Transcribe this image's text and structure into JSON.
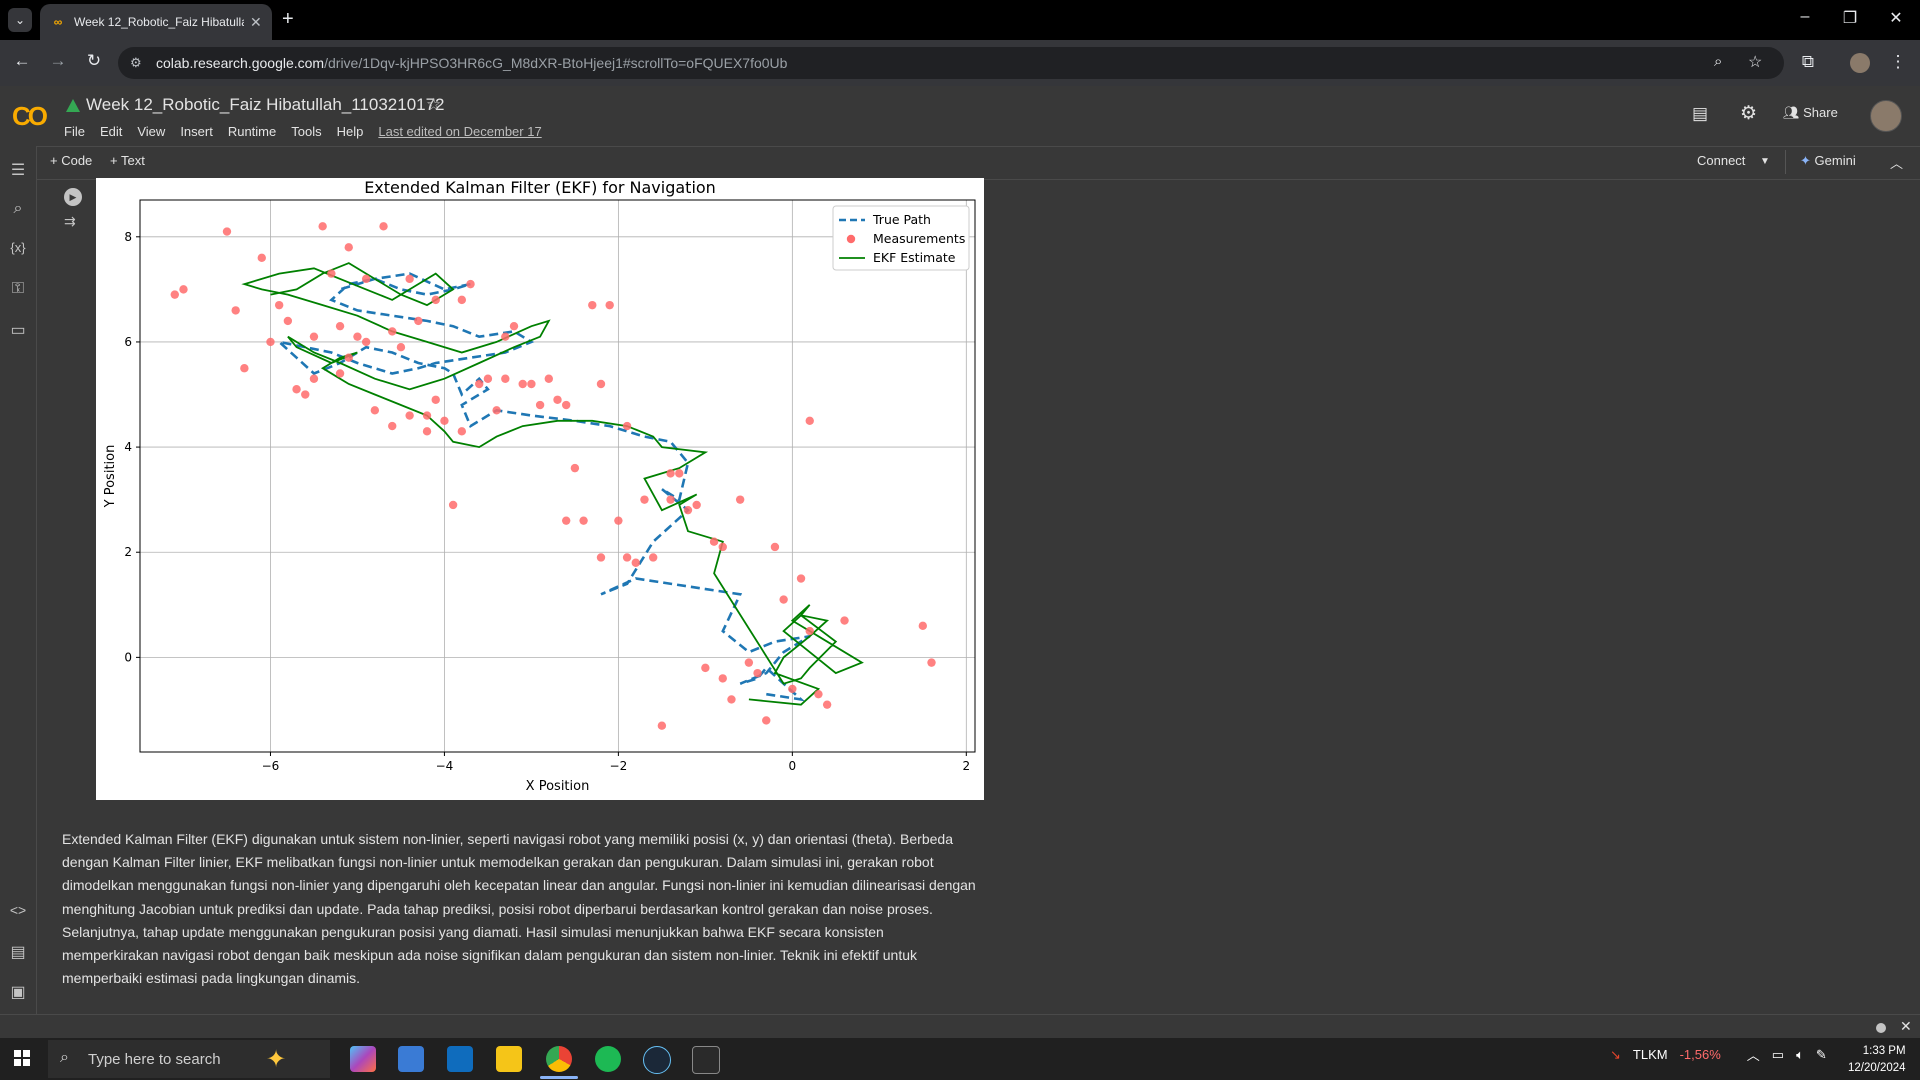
{
  "browser": {
    "tab_title": "Week 12_Robotic_Faiz Hibatulla",
    "url_host": "colab.research.google.com",
    "url_path": "/drive/1Dqv-kjHPSO3HR6cG_M8dXR-BtoHjeej1#scrollTo=oFQUEX7fo0Ub"
  },
  "colab": {
    "logo": "CO",
    "title": "Week 12_Robotic_Faiz Hibatullah_1103210172",
    "menu": [
      "File",
      "Edit",
      "View",
      "Insert",
      "Runtime",
      "Tools",
      "Help"
    ],
    "last_edited": "Last edited on December 17",
    "share_label": "Share",
    "add_code": "+ Code",
    "add_text": "+ Text",
    "connect_label": "Connect",
    "gemini_label": "Gemini"
  },
  "description": "Extended Kalman Filter (EKF) digunakan untuk sistem non-linier, seperti navigasi robot yang memiliki posisi (x, y) dan orientasi (theta). Berbeda dengan Kalman Filter linier, EKF melibatkan fungsi non-linier untuk memodelkan gerakan dan pengukuran. Dalam simulasi ini, gerakan robot dimodelkan menggunakan fungsi non-linier yang dipengaruhi oleh kecepatan linear dan angular. Fungsi non-linier ini kemudian dilinearisasi dengan menghitung Jacobian untuk prediksi dan update. Pada tahap prediksi, posisi robot diperbarui berdasarkan kontrol gerakan dan noise proses. Selanjutnya, tahap update menggunakan pengukuran posisi yang diamati. Hasil simulasi menunjukkan bahwa EKF secara konsisten memperkirakan navigasi robot dengan baik meskipun ada noise signifikan dalam pengukuran dan sistem non-linier. Teknik ini efektif untuk memperbaiki estimasi pada lingkungan dinamis.",
  "taskbar": {
    "search_placeholder": "Type here to search",
    "stock_ticker": "TLKM",
    "stock_change": "-1,56%",
    "time": "1:33 PM",
    "date": "12/20/2024"
  },
  "colors": {
    "true_path": "#1f77b4",
    "measurement": "#ff6b6b",
    "ekf": "#008000",
    "colab_orange": "#f9ab00"
  },
  "chart_data": {
    "type": "line",
    "title": "Extended Kalman Filter (EKF) for Navigation",
    "xlabel": "X Position",
    "ylabel": "Y Position",
    "xlim": [
      -7.5,
      2.1
    ],
    "ylim": [
      -1.8,
      8.7
    ],
    "xticks": [
      -6,
      -4,
      -2,
      0,
      2
    ],
    "yticks": [
      0,
      2,
      4,
      6,
      8
    ],
    "xtick_labels": [
      "−6",
      "−4",
      "−2",
      "0",
      "2"
    ],
    "ytick_labels": [
      "0",
      "2",
      "4",
      "6",
      "8"
    ],
    "grid": true,
    "legend_position": "top-right",
    "series": [
      {
        "name": "True Path",
        "style": "dashed",
        "x": [
          -0.3,
          0.1,
          -0.1,
          -0.3,
          -0.4,
          -0.6,
          -0.3,
          -0.1,
          0.2,
          -0.2,
          -0.5,
          -0.8,
          -0.6,
          -1.8,
          -2.2,
          -1.9,
          -1.6,
          -1.2,
          -1.5,
          -1.3,
          -1.2,
          -1.4,
          -1.7,
          -2.1,
          -2.5,
          -3.0,
          -3.4,
          -3.7,
          -3.8,
          -3.5,
          -3.6,
          -3.8,
          -3.9,
          -4.0,
          -4.3,
          -4.6,
          -4.9,
          -5.2,
          -5.5,
          -5.7,
          -5.9,
          -5.6,
          -5.3,
          -5.0,
          -4.6,
          -4.3,
          -4.1,
          -3.7,
          -3.3,
          -3.0,
          -3.2,
          -3.6,
          -3.9,
          -4.2,
          -4.6,
          -5.0,
          -5.3,
          -5.1,
          -4.8,
          -4.5,
          -4.2,
          -3.9,
          -3.7,
          -4.0,
          -4.4,
          -4.8,
          -5.2
        ],
        "y": [
          -0.7,
          -0.8,
          -0.5,
          -0.2,
          -0.4,
          -0.5,
          -0.3,
          0.1,
          0.4,
          0.3,
          0.1,
          0.5,
          1.2,
          1.5,
          1.2,
          1.4,
          2.2,
          2.8,
          3.2,
          3.0,
          3.7,
          4.1,
          4.2,
          4.4,
          4.5,
          4.6,
          4.7,
          4.4,
          4.8,
          5.1,
          5.3,
          5.0,
          5.4,
          5.5,
          5.6,
          5.8,
          5.9,
          5.6,
          5.4,
          5.7,
          6.0,
          5.9,
          5.8,
          5.6,
          5.4,
          5.5,
          5.6,
          5.7,
          5.8,
          6.0,
          6.2,
          6.1,
          6.3,
          6.4,
          6.5,
          6.6,
          6.8,
          7.1,
          7.2,
          7.0,
          6.9,
          7.0,
          7.1,
          7.0,
          7.3,
          7.2,
          7.0
        ]
      },
      {
        "name": "EKF Estimate",
        "style": "solid",
        "x": [
          -0.5,
          0.1,
          0.3,
          -0.2,
          -0.1,
          0.2,
          0.4,
          0.1,
          -0.1,
          0.2,
          0.5,
          0.8,
          0.3,
          0.0,
          0.2,
          0.1,
          0.5,
          0.2,
          0.1,
          -0.1,
          -0.9,
          -0.8,
          -1.2,
          -1.3,
          -1.1,
          -1.5,
          -1.7,
          -1.3,
          -1.0,
          -1.5,
          -1.6,
          -1.9,
          -2.3,
          -2.7,
          -3.1,
          -3.4,
          -3.6,
          -3.9,
          -4.0,
          -4.2,
          -4.5,
          -4.8,
          -5.1,
          -5.4,
          -5.2,
          -5.0,
          -5.3,
          -5.7,
          -5.8,
          -5.5,
          -5.2,
          -4.8,
          -4.4,
          -4.0,
          -3.6,
          -3.2,
          -2.9,
          -2.8,
          -3.0,
          -3.4,
          -3.8,
          -4.2,
          -4.6,
          -5.0,
          -5.4,
          -5.8,
          -6.1,
          -6.3,
          -5.9,
          -5.5,
          -5.2,
          -4.9,
          -4.6,
          -4.3,
          -4.1,
          -3.9,
          -4.2,
          -4.5,
          -4.8,
          -5.1,
          -5.4,
          -5.7,
          -6.0
        ],
        "y": [
          -0.8,
          -0.9,
          -0.6,
          -0.3,
          0.0,
          0.4,
          0.7,
          0.8,
          0.5,
          0.1,
          -0.3,
          -0.1,
          0.4,
          0.7,
          1.0,
          0.8,
          0.3,
          -0.2,
          -0.4,
          -0.5,
          1.6,
          2.2,
          2.4,
          2.9,
          3.1,
          2.8,
          3.4,
          3.6,
          3.9,
          4.0,
          4.2,
          4.4,
          4.5,
          4.5,
          4.4,
          4.2,
          4.0,
          4.1,
          4.3,
          4.6,
          4.8,
          5.0,
          5.2,
          5.5,
          5.7,
          5.8,
          5.6,
          5.9,
          6.1,
          5.8,
          5.6,
          5.3,
          5.1,
          5.3,
          5.6,
          5.9,
          6.1,
          6.4,
          6.3,
          6.0,
          5.8,
          6.0,
          6.2,
          6.5,
          6.7,
          6.9,
          7.0,
          7.1,
          7.3,
          7.4,
          7.2,
          7.0,
          6.8,
          7.1,
          7.3,
          7.0,
          6.7,
          6.9,
          7.2,
          7.5,
          7.3,
          7.0,
          6.9
        ]
      },
      {
        "name": "Measurements",
        "style": "markers",
        "x": [
          -7.1,
          -7.0,
          -6.5,
          -6.4,
          -6.3,
          -6.1,
          -5.9,
          -5.8,
          -5.6,
          -5.5,
          -5.4,
          -5.3,
          -5.2,
          -5.1,
          -5.0,
          -4.9,
          -4.8,
          -4.7,
          -4.6,
          -4.5,
          -4.4,
          -4.3,
          -4.2,
          -4.1,
          -4.0,
          -3.9,
          -3.8,
          -3.7,
          -3.6,
          -3.5,
          -3.4,
          -3.3,
          -3.2,
          -3.1,
          -3.0,
          -2.9,
          -2.8,
          -2.7,
          -2.6,
          -2.5,
          -2.4,
          -2.3,
          -2.2,
          -2.1,
          -2.0,
          -1.9,
          -1.8,
          -1.7,
          -1.6,
          -1.5,
          -1.4,
          -1.3,
          -1.2,
          -1.1,
          -1.0,
          -0.9,
          -0.8,
          -0.7,
          -0.6,
          -0.5,
          -0.4,
          -0.3,
          -0.2,
          -0.1,
          0.0,
          0.1,
          0.2,
          0.3,
          0.4,
          0.6,
          1.5,
          1.6,
          -6.0,
          -5.7,
          -5.2,
          -4.9,
          -4.4,
          -4.1,
          -3.8,
          -3.3,
          -2.6,
          -2.2,
          -1.9,
          -1.4,
          -0.8,
          0.2,
          -5.5,
          -5.1,
          -4.6,
          -4.2
        ],
        "y": [
          6.9,
          7.0,
          8.1,
          6.6,
          5.5,
          7.6,
          6.7,
          6.4,
          5.0,
          5.3,
          8.2,
          7.3,
          6.3,
          7.8,
          6.1,
          7.2,
          4.7,
          8.2,
          6.2,
          5.9,
          7.2,
          6.4,
          4.6,
          6.8,
          4.5,
          2.9,
          6.8,
          7.1,
          5.2,
          5.3,
          4.7,
          6.1,
          6.3,
          5.2,
          5.2,
          4.8,
          5.3,
          4.9,
          2.6,
          3.6,
          2.6,
          6.7,
          1.9,
          6.7,
          2.6,
          1.9,
          1.8,
          3.0,
          1.9,
          -1.3,
          3.0,
          3.5,
          2.8,
          2.9,
          -0.2,
          2.2,
          -0.4,
          -0.8,
          3.0,
          -0.1,
          -0.3,
          -1.2,
          2.1,
          1.1,
          -0.6,
          1.5,
          4.5,
          -0.7,
          -0.9,
          0.7,
          0.6,
          -0.1,
          6.0,
          5.1,
          5.4,
          6.0,
          4.6,
          4.9,
          4.3,
          5.3,
          4.8,
          5.2,
          4.4,
          3.5,
          2.1,
          0.5,
          6.1,
          5.7,
          4.4,
          4.3
        ]
      }
    ]
  }
}
